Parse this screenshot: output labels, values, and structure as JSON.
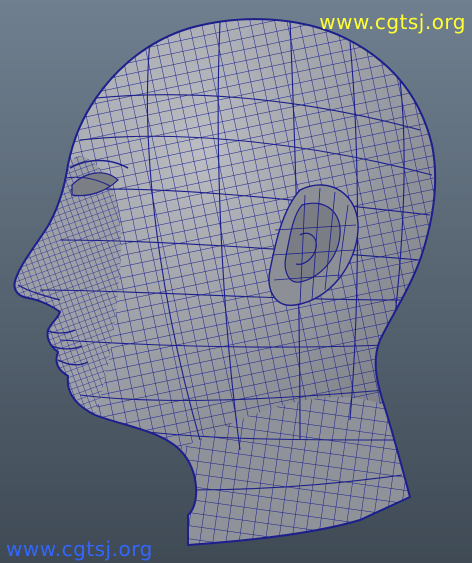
{
  "viewport": {
    "background_top": "#6f7f8f",
    "background_bottom": "#3f4a55"
  },
  "model": {
    "subject": "wireframe head",
    "surface_color": "#9b9ea4",
    "wire_color": "#1c1f8c"
  },
  "watermarks": {
    "top_right": {
      "text": "www.cgtsj.org",
      "color": "#ffff33"
    },
    "bottom_left": {
      "text": "www.cgtsj.org",
      "color": "#3366ff"
    }
  }
}
